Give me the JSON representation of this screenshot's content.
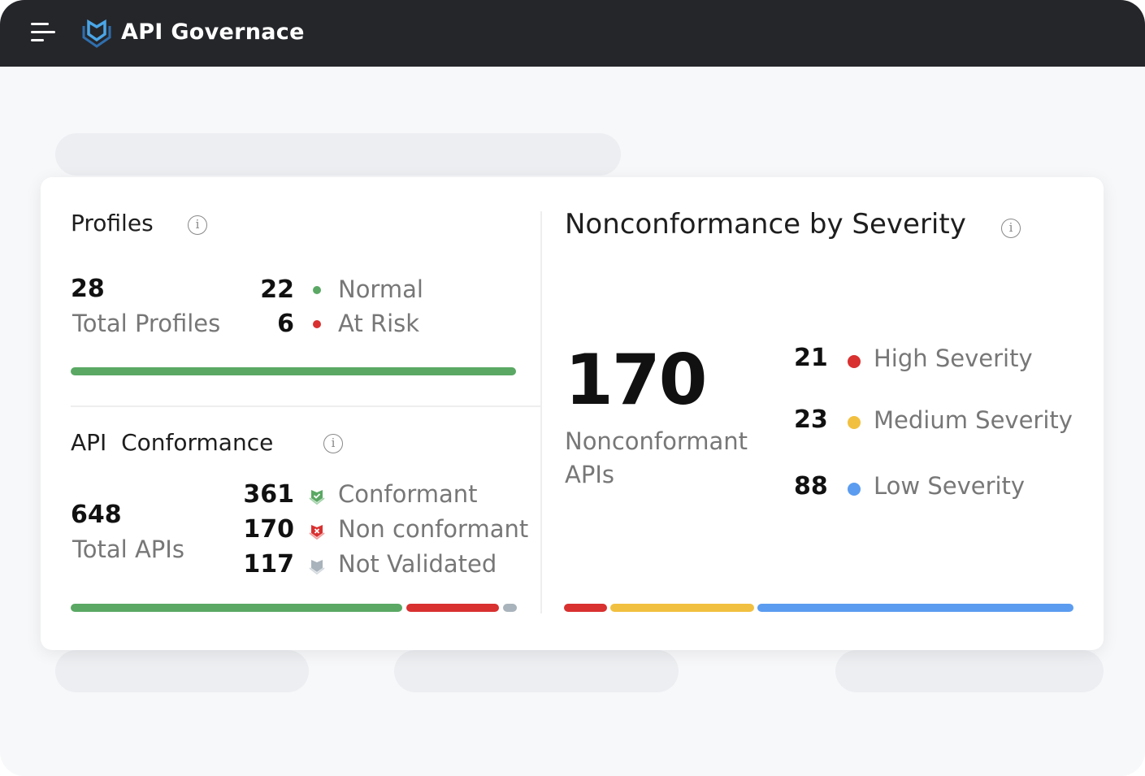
{
  "header": {
    "title": "API Governace",
    "menu_icon": "hamburger-menu-icon",
    "logo_icon": "shield-logo-icon"
  },
  "profiles": {
    "title": "Profiles",
    "total": "28",
    "total_label": "Total Profiles",
    "items": [
      {
        "count": "22",
        "label": "Normal",
        "color": "#5aa864"
      },
      {
        "count": "6",
        "label": "At Risk",
        "color": "#d93030"
      }
    ]
  },
  "conformance": {
    "title": "API  Conformance",
    "total": "648",
    "total_label": "Total APIs",
    "items": [
      {
        "count": "361",
        "label": "Conformant",
        "color": "#5aa864",
        "icon": "shield-check-icon"
      },
      {
        "count": "170",
        "label": "Non conformant",
        "color": "#d93030",
        "icon": "shield-x-icon"
      },
      {
        "count": "117",
        "label": "Not Validated",
        "color": "#a8b3bb",
        "icon": "shield-icon"
      }
    ]
  },
  "severity": {
    "title": "Nonconformance by Severity",
    "total": "170",
    "total_label_1": "Nonconformant",
    "total_label_2": "APIs",
    "items": [
      {
        "count": "21",
        "label": "High Severity",
        "color": "#d93030"
      },
      {
        "count": "23",
        "label": "Medium Severity",
        "color": "#f2c040"
      },
      {
        "count": "88",
        "label": "Low Severity",
        "color": "#5b9cf0"
      }
    ]
  }
}
